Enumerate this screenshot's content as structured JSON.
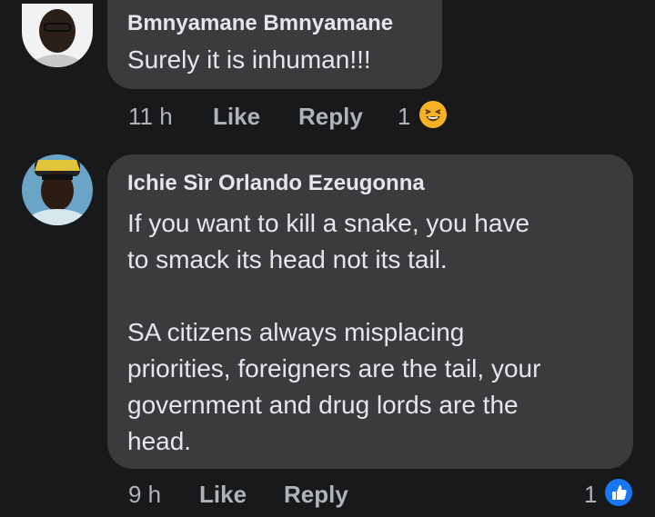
{
  "comments": [
    {
      "author": "Bmnyamane Bmnyamane",
      "text": "Surely it is inhuman!!!",
      "time": "11 h",
      "like_label": "Like",
      "reply_label": "Reply",
      "reaction_count": "1",
      "reaction_icon": "haha-emoji-icon"
    },
    {
      "author": "Ichie Sìr Orlando Ezeugonna",
      "text": "If you want to kill a snake, you have\nto smack its head not its tail.\n\nSA citizens always misplacing\npriorities, foreigners are the tail, your\ngovernment and drug lords are the\nhead.",
      "time": "9 h",
      "like_label": "Like",
      "reply_label": "Reply",
      "reaction_count": "1",
      "reaction_icon": "like-thumb-icon"
    }
  ]
}
